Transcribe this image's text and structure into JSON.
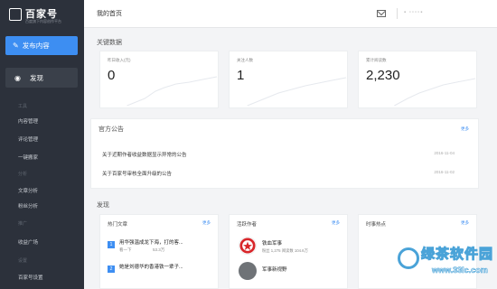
{
  "sidebar": {
    "logo_title": "百家号",
    "logo_subtitle": "百度旗下内容创作平台",
    "publish_label": "发布内容",
    "discover_label": "发现",
    "sections": [
      {
        "label": "工具",
        "items": [
          "内容管理",
          "评论管理",
          "一键搬家"
        ]
      },
      {
        "label": "分析",
        "items": [
          "文章分析",
          "粉丝分析"
        ]
      },
      {
        "label": "推广",
        "items": [
          "收益广场"
        ]
      },
      {
        "label": "设置",
        "items": [
          "百家号设置"
        ]
      }
    ]
  },
  "topbar": {
    "breadcrumb": "我的首页",
    "username": "▪ ▫▫▫▫▪"
  },
  "key_data": {
    "title": "关键数据",
    "stats": [
      {
        "label": "昨日收入(元)",
        "value": "0"
      },
      {
        "label": "关注人数",
        "value": "1"
      },
      {
        "label": "累计阅读数",
        "value": "2,230"
      }
    ]
  },
  "announcements": {
    "title": "官方公告",
    "more": "更多",
    "items": [
      {
        "text": "关于近期作者收益数据显示异常的公告",
        "date": "2016-11-04"
      },
      {
        "text": "关于百家号审核全面升级的公告",
        "date": "2016-11-02"
      }
    ]
  },
  "discover": {
    "title": "发现",
    "hot_articles": {
      "title": "热门文章",
      "more": "更多",
      "items": [
        {
          "rank": "1",
          "title": "用华强温成龙下海，打的客...",
          "author": "看一下",
          "views": "53.3万"
        },
        {
          "rank": "2",
          "title": "她是刘德华的香港铁一辈子...",
          "author": "",
          "views": ""
        }
      ]
    },
    "active_authors": {
      "title": "活跃作者",
      "more": "更多",
      "items": [
        {
          "name": "铁血军事",
          "meta": "粉丝 1,275  阅读数 104.6万"
        },
        {
          "name": "军事新视野",
          "meta": ""
        }
      ]
    },
    "hot_topics": {
      "title": "时事热点",
      "more": "更多"
    }
  },
  "watermark": {
    "text": "绿茶软件园",
    "url": "www.33lc.com"
  },
  "colors": {
    "sidebar_bg": "#2c313b",
    "accent": "#3d8ef2",
    "page_bg": "#f3f4f6"
  }
}
